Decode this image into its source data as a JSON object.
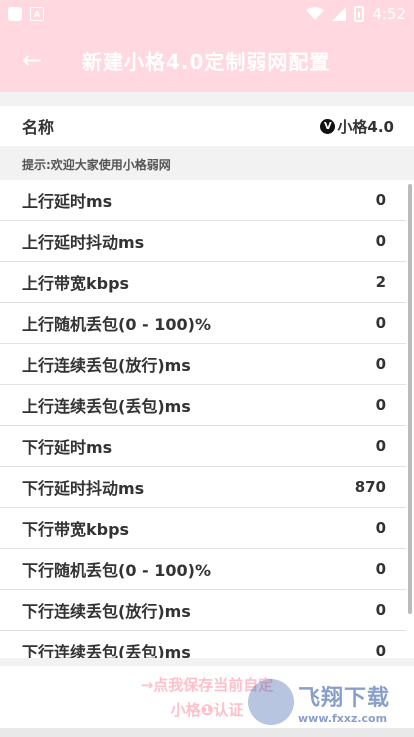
{
  "statusbar": {
    "time": "4:52",
    "notif_icon": "A"
  },
  "appbar": {
    "back_icon": "←",
    "title": "新建小格4.0定制弱网配置"
  },
  "name_row": {
    "label": "名称",
    "badge": "V",
    "value": "小格4.0"
  },
  "tip": "提示:欢迎大家使用小格弱网",
  "rows": [
    {
      "label": "上行延时ms",
      "value": "0"
    },
    {
      "label": "上行延时抖动ms",
      "value": "0"
    },
    {
      "label": "上行带宽kbps",
      "value": "2"
    },
    {
      "label": "上行随机丢包(0 - 100)%",
      "value": "0"
    },
    {
      "label": "上行连续丢包(放行)ms",
      "value": "0"
    },
    {
      "label": "上行连续丢包(丢包)ms",
      "value": "0"
    },
    {
      "label": "下行延时ms",
      "value": "0"
    },
    {
      "label": "下行延时抖动ms",
      "value": "870"
    },
    {
      "label": "下行带宽kbps",
      "value": "0"
    },
    {
      "label": "下行随机丢包(0 - 100)%",
      "value": "0"
    },
    {
      "label": "下行连续丢包(放行)ms",
      "value": "0"
    },
    {
      "label": "下行连续丢包(丢包)ms",
      "value": "0"
    }
  ],
  "footer": {
    "line1": "→点我保存当前自定",
    "line2": "小格❶认证"
  },
  "watermark": {
    "main": "飞翔下载",
    "sub": "www.fxxz.com"
  },
  "colors": {
    "accent": "#ffd9df",
    "footer_text": "#ffc0cb"
  }
}
